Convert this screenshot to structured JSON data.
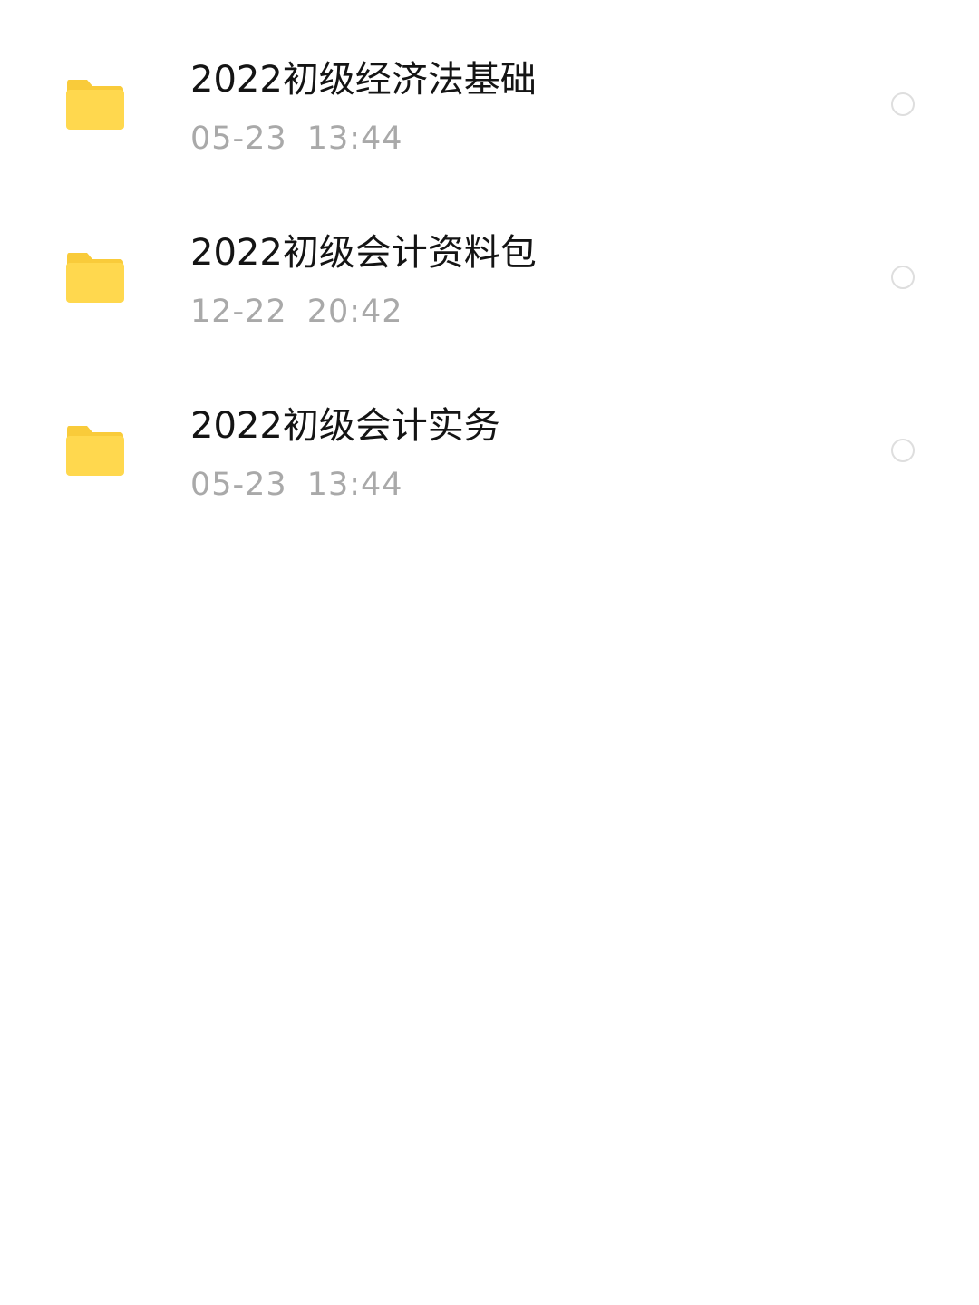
{
  "files": [
    {
      "name": "2022初级经济法基础",
      "date": "05-23",
      "time": "13:44",
      "icon": "folder-icon"
    },
    {
      "name": "2022初级会计资料包",
      "date": "12-22",
      "time": "20:42",
      "icon": "folder-icon"
    },
    {
      "name": "2022初级会计实务",
      "date": "05-23",
      "time": "13:44",
      "icon": "folder-icon"
    }
  ],
  "colors": {
    "folder_fill": "#FFD84E",
    "folder_tab": "#F9CB3A",
    "title_text": "#141414",
    "meta_text": "#A9A9A9",
    "radio_border": "#DEDEDE"
  }
}
